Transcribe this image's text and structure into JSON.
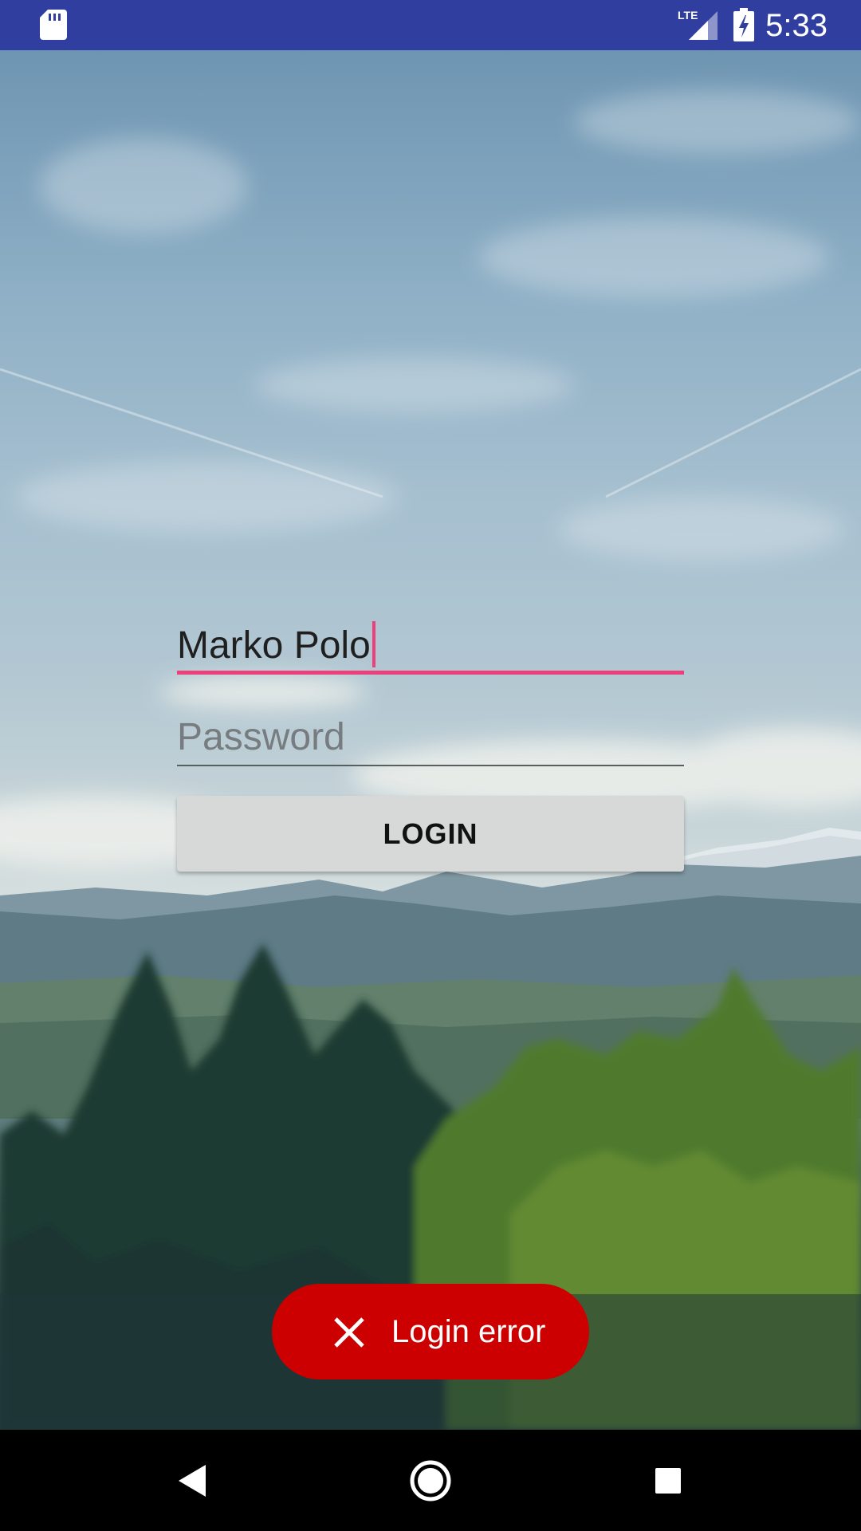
{
  "status_bar": {
    "time": "5:33",
    "network_label": "LTE",
    "icons": [
      "sd-card-icon",
      "lte-signal-icon",
      "battery-charging-icon"
    ]
  },
  "login_form": {
    "username_value": "Marko Polo",
    "password_placeholder": "Password",
    "login_button_label": "LOGIN"
  },
  "toast": {
    "message": "Login error",
    "icon": "close-icon"
  },
  "navigation_bar": {
    "icons": [
      "back-icon",
      "home-icon",
      "recents-icon"
    ]
  },
  "colors": {
    "status_bar": "#303f9f",
    "accent": "#ec407a",
    "button_background": "#d7d8d8",
    "toast_background": "#cc0000",
    "nav_bar": "#000000"
  }
}
